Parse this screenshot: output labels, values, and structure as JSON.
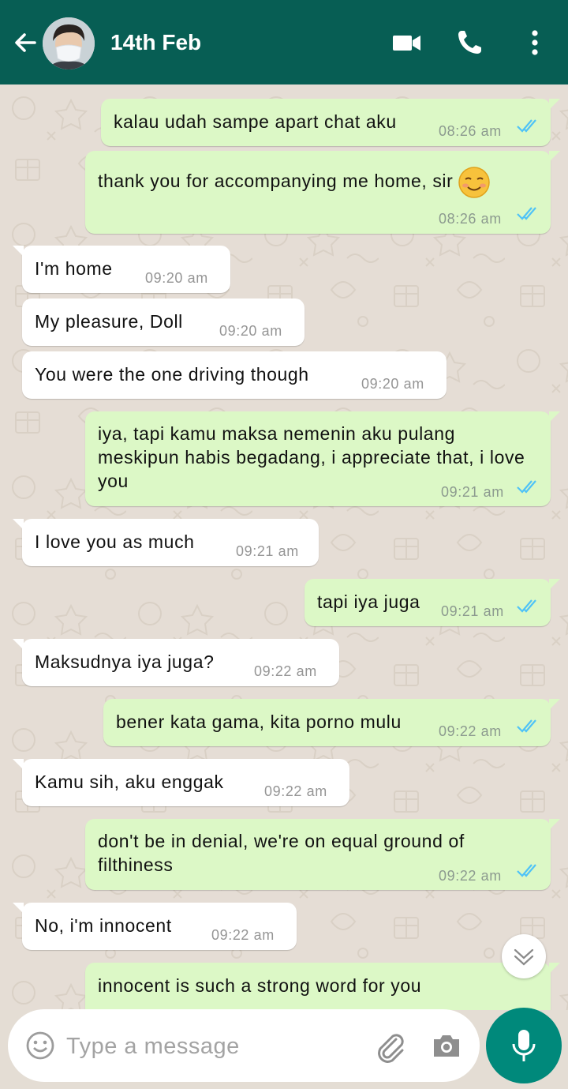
{
  "header": {
    "title": "14th Feb",
    "back_icon": "arrow-left-icon",
    "video_icon": "video-camera-icon",
    "call_icon": "phone-icon",
    "menu_icon": "more-vertical-icon"
  },
  "messages": [
    {
      "dir": "out",
      "text": "kalau udah sampe apart chat aku",
      "time": "08:26 am",
      "read": true
    },
    {
      "dir": "out",
      "text": "thank you for accompanying me home, sir",
      "emoji": "smiling-face-icon",
      "time": "08:26 am",
      "read": true
    },
    {
      "dir": "in",
      "text": "I'm home",
      "time": "09:20 am"
    },
    {
      "dir": "in",
      "text": "My pleasure, Doll",
      "time": "09:20 am"
    },
    {
      "dir": "in",
      "text": "You were the one driving though",
      "time": "09:20 am"
    },
    {
      "dir": "out",
      "text": "iya, tapi kamu maksa nemenin aku pulang meskipun habis begadang, i appreciate that, i love you",
      "time": "09:21 am",
      "read": true
    },
    {
      "dir": "in",
      "text": "I love you as much",
      "time": "09:21 am"
    },
    {
      "dir": "out",
      "text": "tapi iya juga",
      "time": "09:21 am",
      "read": true
    },
    {
      "dir": "in",
      "text": "Maksudnya iya juga?",
      "time": "09:22 am"
    },
    {
      "dir": "out",
      "text": "bener kata gama, kita porno mulu",
      "time": "09:22 am",
      "read": true
    },
    {
      "dir": "in",
      "text": "Kamu sih, aku enggak",
      "time": "09:22 am"
    },
    {
      "dir": "out",
      "text": "don't be in denial, we're on equal ground of filthiness",
      "time": "09:22 am",
      "read": true
    },
    {
      "dir": "in",
      "text": "No, i'm innocent",
      "time": "09:22 am"
    },
    {
      "dir": "out",
      "text": "innocent is such a strong word for you",
      "time": "",
      "read": false
    }
  ],
  "input": {
    "placeholder": "Type a message",
    "emoji_icon": "smiley-icon",
    "attach_icon": "paperclip-icon",
    "camera_icon": "camera-icon",
    "mic_icon": "microphone-icon"
  },
  "scroll_button_icon": "chevron-double-down-icon",
  "colors": {
    "header": "#075e54",
    "outgoing_bubble": "#dcf8c6",
    "incoming_bubble": "#ffffff",
    "read_ticks": "#4fc3f7",
    "mic_button": "#00897b",
    "chat_background": "#e5ddd5"
  }
}
